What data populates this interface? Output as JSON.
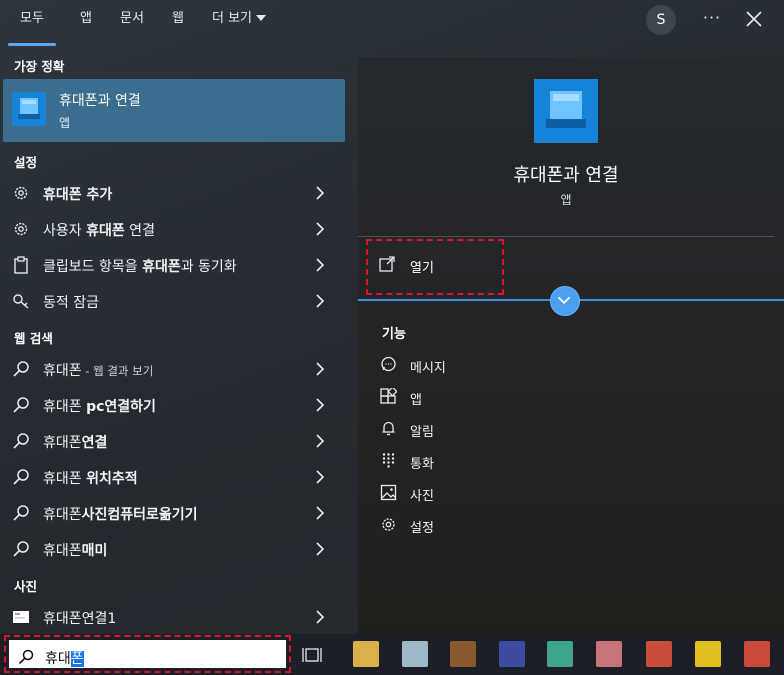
{
  "tabs": {
    "all": "모두",
    "apps": "앱",
    "documents": "문서",
    "web": "웹",
    "more": "더 보기"
  },
  "account_initial": "S",
  "more_options": "···",
  "left": {
    "best_match_title": "가장 정확",
    "best_match": {
      "name": "휴대폰과 연결",
      "type": "앱"
    },
    "settings_title": "설정",
    "settings": [
      {
        "pre": "",
        "bold": "휴대폰 추가",
        "post": ""
      },
      {
        "pre": "사용자 ",
        "bold": "휴대폰",
        "post": " 연결"
      },
      {
        "pre": "클립보드 항목을 ",
        "bold": "휴대폰",
        "post": "과 동기화"
      },
      {
        "pre": "",
        "bold": "",
        "post": "동적 잠금"
      }
    ],
    "web_title": "웹 검색",
    "web": [
      {
        "pre": "휴대폰",
        "bold": "",
        "small": " - 웹 결과 보기"
      },
      {
        "pre": "휴대폰 ",
        "bold": "pc연결하기",
        "small": ""
      },
      {
        "pre": "휴대폰",
        "bold": "연결",
        "small": ""
      },
      {
        "pre": "휴대폰 ",
        "bold": "위치추적",
        "small": ""
      },
      {
        "pre": "휴대폰",
        "bold": "사진컴퓨터로옮기기",
        "small": ""
      },
      {
        "pre": "휴대폰",
        "bold": "매미",
        "small": ""
      }
    ],
    "photos_title": "사진",
    "photos": [
      {
        "label": "휴대폰연결1"
      }
    ]
  },
  "preview": {
    "app_name": "휴대폰과 연결",
    "app_type": "앱",
    "open_label": "열기",
    "features_title": "기능",
    "features": [
      "메시지",
      "앱",
      "알림",
      "통화",
      "사진",
      "설정"
    ]
  },
  "search": {
    "typed": "휴대",
    "selected": "폰"
  },
  "colors": {
    "accent": "#5aa9ff",
    "highlight": "#3a6d8e",
    "annotation": "#e3102a"
  },
  "taskbar_apps": [
    {
      "color": "#d9b04a"
    },
    {
      "color": "#9fb8c7"
    },
    {
      "color": "#8a5a2e"
    },
    {
      "color": "#3d4aa0"
    },
    {
      "color": "#3fa38e"
    },
    {
      "color": "#c7747a"
    },
    {
      "color": "#c84d3c"
    },
    {
      "color": "#e0c020"
    },
    {
      "color": "#c94a3a"
    }
  ]
}
